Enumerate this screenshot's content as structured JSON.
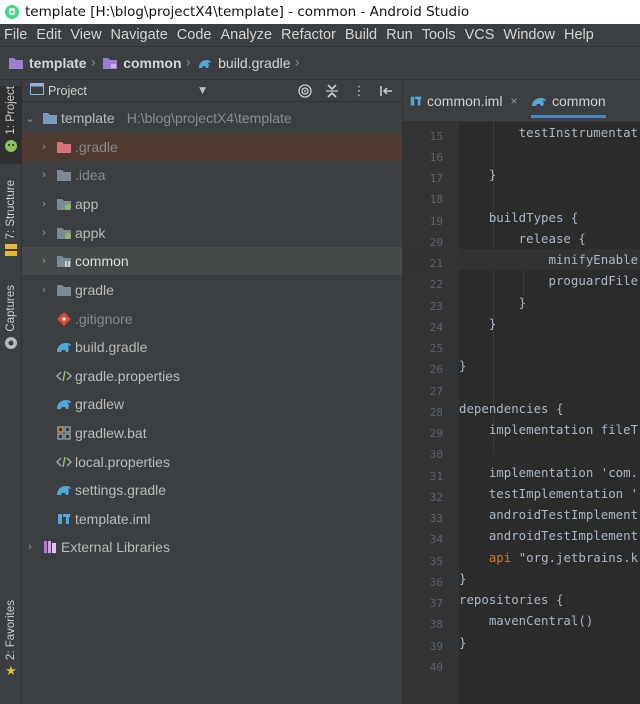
{
  "window": {
    "title": "template [H:\\blog\\projectX4\\template] - common - Android Studio"
  },
  "menu": [
    "File",
    "Edit",
    "View",
    "Navigate",
    "Code",
    "Analyze",
    "Refactor",
    "Build",
    "Run",
    "Tools",
    "VCS",
    "Window",
    "Help"
  ],
  "breadcrumb": {
    "root": "template",
    "module": "common",
    "file": "build.gradle"
  },
  "tool_windows": {
    "project": "1: Project",
    "structure": "7: Structure",
    "captures": "Captures",
    "favorites": "2: Favorites"
  },
  "project_panel": {
    "view_mode": "Project",
    "root": {
      "name": "template",
      "path": "H:\\blog\\projectX4\\template"
    },
    "items": [
      {
        "label": ".gradle",
        "icon": "folder-icon"
      },
      {
        "label": ".idea",
        "icon": "folder-icon"
      },
      {
        "label": "app",
        "icon": "module-folder-icon"
      },
      {
        "label": "appk",
        "icon": "module-folder-icon"
      },
      {
        "label": "common",
        "icon": "library-module-icon"
      },
      {
        "label": "gradle",
        "icon": "folder-icon"
      },
      {
        "label": ".gitignore",
        "icon": "git-file-icon"
      },
      {
        "label": "build.gradle",
        "icon": "gradle-icon"
      },
      {
        "label": "gradle.properties",
        "icon": "properties-file-icon"
      },
      {
        "label": "gradlew",
        "icon": "gradle-icon"
      },
      {
        "label": "gradlew.bat",
        "icon": "batch-file-icon"
      },
      {
        "label": "local.properties",
        "icon": "properties-file-icon"
      },
      {
        "label": "settings.gradle",
        "icon": "gradle-icon"
      },
      {
        "label": "template.iml",
        "icon": "iml-file-icon"
      },
      {
        "label": "External Libraries",
        "icon": "libraries-icon"
      }
    ]
  },
  "editor": {
    "tabs": [
      {
        "label": "common.iml",
        "close": "×"
      },
      {
        "label": "common",
        "close": ""
      }
    ],
    "line_numbers": [
      "15",
      "16",
      "17",
      "18",
      "19",
      "20",
      "21",
      "22",
      "23",
      "24",
      "25",
      "26",
      "27",
      "28",
      "29",
      "30",
      "31",
      "32",
      "33",
      "34",
      "35",
      "36",
      "37",
      "38",
      "39",
      "40"
    ],
    "code_lines": [
      "        testInstrumentat",
      "",
      "    }",
      "",
      "    buildTypes {",
      "        release {",
      "            minifyEnable",
      "            proguardFile",
      "        }",
      "    }",
      "",
      "}",
      "",
      "dependencies {",
      "    implementation fileT",
      "",
      "    implementation 'com.",
      "    testImplementation '",
      "    androidTestImplement",
      "    androidTestImplement",
      "    api \"org.jetbrains.k",
      "}",
      "repositories {",
      "    mavenCentral()",
      "}",
      ""
    ],
    "current_line": 21
  }
}
